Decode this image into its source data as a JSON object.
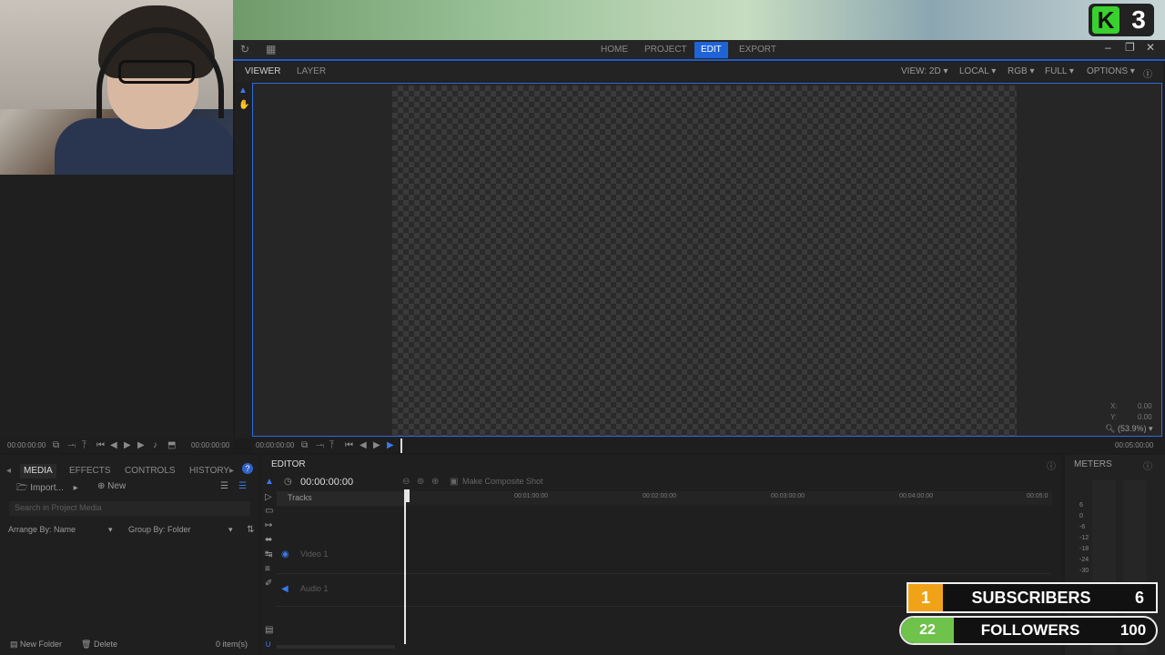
{
  "app": {
    "top_nav": [
      {
        "label": "HOME",
        "active": false
      },
      {
        "label": "PROJECT",
        "active": false
      },
      {
        "label": "EDIT",
        "active": true
      },
      {
        "label": "EXPORT",
        "active": false
      }
    ]
  },
  "viewer": {
    "tabs": [
      {
        "label": "VIEWER",
        "active": true
      },
      {
        "label": "LAYER",
        "active": false
      }
    ],
    "dropdowns": [
      "VIEW: 2D",
      "LOCAL",
      "RGB",
      "FULL",
      "OPTIONS"
    ],
    "x_label": "X:",
    "x_value": "0.00",
    "y_label": "Y:",
    "y_value": "0.00",
    "zoom": "(53.9%)",
    "timecode_start": "00:00:00:00",
    "timecode_end": "00:05:00:00"
  },
  "left_transport": {
    "timecode_start": "00:00:00:00",
    "timecode_end": "00:00:00:00"
  },
  "media_panel": {
    "tabs": [
      {
        "label": "MEDIA",
        "active": true
      },
      {
        "label": "EFFECTS",
        "active": false
      },
      {
        "label": "CONTROLS",
        "active": false
      },
      {
        "label": "HISTORY",
        "active": false
      }
    ],
    "import_label": "Import...",
    "new_label": "New",
    "search_placeholder": "Search in Project Media",
    "arrange_label": "Arrange By: Name",
    "group_label": "Group By: Folder",
    "new_folder_label": "New Folder",
    "delete_label": "Delete",
    "item_count": "0 item(s)"
  },
  "editor": {
    "title": "EDITOR",
    "timecode": "00:00:00:00",
    "make_composite": "Make Composite Shot",
    "tracks_label": "Tracks",
    "ruler_marks": [
      "00:01:00:00",
      "00:02:00:00",
      "00:03:00:00",
      "00:04:00:00",
      "00:05:0"
    ],
    "tracks": [
      {
        "name": "Video 1",
        "type": "video"
      },
      {
        "name": "Audio 1",
        "type": "audio"
      }
    ]
  },
  "meters": {
    "title": "METERS",
    "scale": [
      "6",
      "0",
      "-6",
      "-12",
      "-18",
      "-24",
      "-30"
    ]
  },
  "overlay": {
    "k_letter": "K",
    "k_count": "3",
    "subscribers_count": "1",
    "subscribers_label": "SUBSCRIBERS",
    "subscribers_goal": "6",
    "followers_count": "22",
    "followers_label": "FOLLOWERS",
    "followers_goal": "100"
  },
  "colors": {
    "accent": "#1f64d6",
    "subscribers": "#f0a317",
    "followers": "#6fc24a",
    "kick": "#39d12e"
  }
}
